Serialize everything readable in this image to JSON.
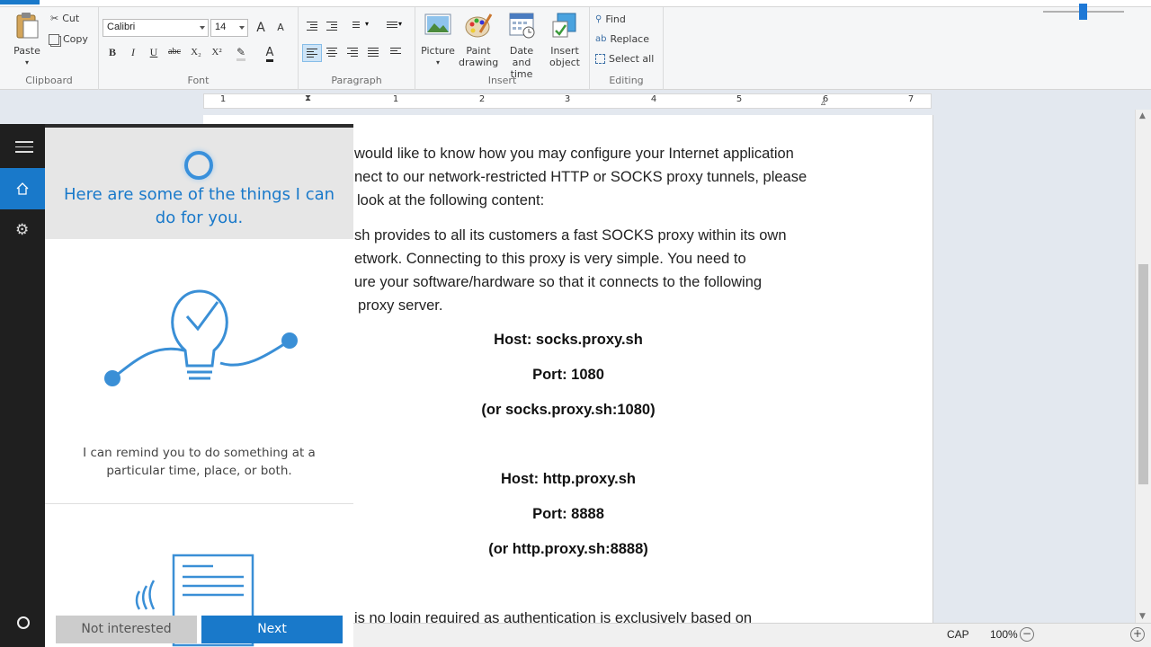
{
  "ribbon": {
    "clipboard": {
      "paste": "Paste",
      "cut": "Cut",
      "copy": "Copy",
      "label": "Clipboard"
    },
    "font": {
      "family": "Calibri",
      "size": "14",
      "label": "Font",
      "bold": "B",
      "italic": "I",
      "underline": "U",
      "strike": "abc",
      "subscript": "X₂",
      "superscript": "X²"
    },
    "paragraph": {
      "label": "Paragraph"
    },
    "insert": {
      "picture": "Picture",
      "paint_line1": "Paint",
      "paint_line2": "drawing",
      "datetime_line1": "Date and",
      "datetime_line2": "time",
      "object_line1": "Insert",
      "object_line2": "object",
      "label": "Insert"
    },
    "editing": {
      "find": "Find",
      "replace": "Replace",
      "select_all": "Select all",
      "label": "Editing"
    }
  },
  "ruler": {
    "numbers": [
      "1",
      "1",
      "2",
      "3",
      "4",
      "5",
      "6",
      "7"
    ]
  },
  "document": {
    "para1": [
      "would like to know how you may configure your Internet application",
      "nect to our network-restricted HTTP or SOCKS proxy tunnels, please",
      "look at the following content:"
    ],
    "para2": [
      "sh provides to all its customers a fast SOCKS proxy within its own",
      "etwork. Connecting to this proxy is very simple. You need to",
      "ure your software/hardware so that it connects to the following",
      "proxy server."
    ],
    "socks_host": "Host: socks.proxy.sh",
    "socks_port": "Port: 1080",
    "socks_combined": "(or socks.proxy.sh:1080)",
    "http_host": "Host: http.proxy.sh",
    "http_port": "Port: 8888",
    "http_combined": "(or http.proxy.sh:8888)",
    "last_line": "is no login required as authentication is exclusively based on"
  },
  "statusbar": {
    "caps": "CAP",
    "zoom": "100%",
    "zoom_out": "−",
    "zoom_in": "+"
  },
  "cortana": {
    "title": "Here are some of the things I can do for you.",
    "description": "I can remind you to do something at a particular time, place, or both.",
    "btn_not_interested": "Not interested",
    "btn_next": "Next"
  },
  "colors": {
    "accent": "#1979ca",
    "panel_bg": "#e6e6e6",
    "rail_bg": "#1f1f1f"
  }
}
